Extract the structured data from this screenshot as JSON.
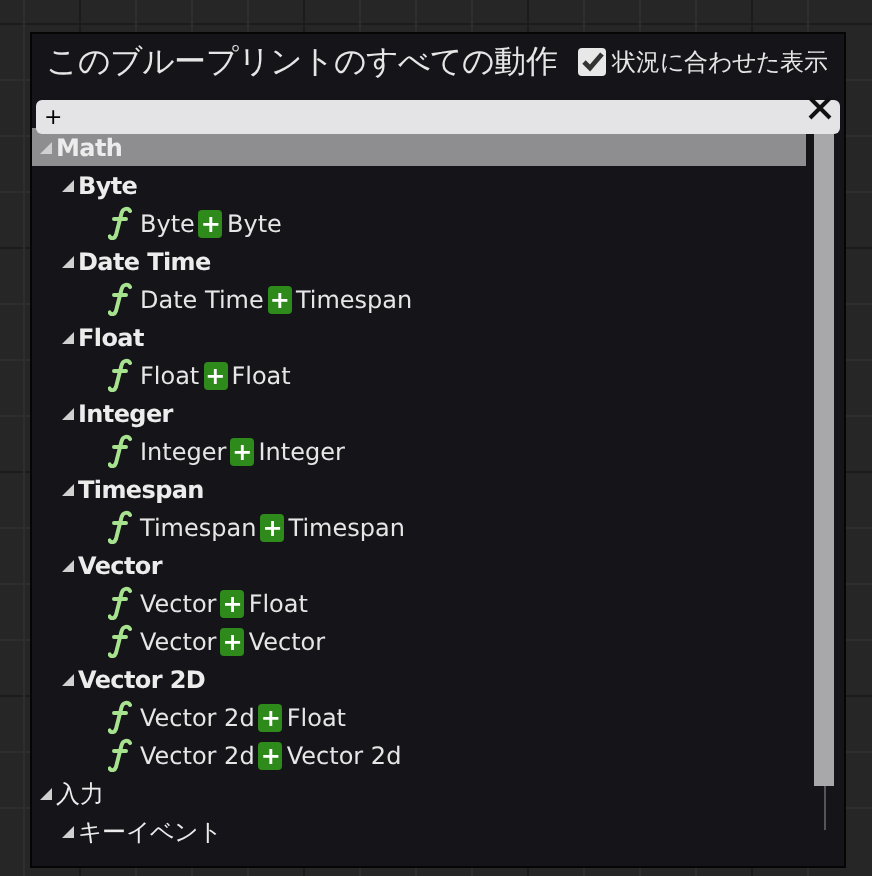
{
  "title": "このブループリントのすべての動作",
  "context_sensitive": {
    "label": "状況に合わせた表示",
    "checked": true
  },
  "search": {
    "value": "+"
  },
  "tree": [
    {
      "kind": "category",
      "label": "Math",
      "expanded": true,
      "selected": true,
      "children": [
        {
          "kind": "category",
          "label": "Byte",
          "expanded": true,
          "selected": false,
          "children": [
            {
              "kind": "function",
              "before": "Byte",
              "match": "+",
              "after": "Byte",
              "selected": false
            }
          ]
        },
        {
          "kind": "category",
          "label": "Date Time",
          "expanded": true,
          "selected": false,
          "children": [
            {
              "kind": "function",
              "before": "Date Time",
              "match": "+",
              "after": "Timespan",
              "selected": false
            }
          ]
        },
        {
          "kind": "category",
          "label": "Float",
          "expanded": true,
          "selected": false,
          "children": [
            {
              "kind": "function",
              "before": "Float",
              "match": "+",
              "after": "Float",
              "selected": false
            }
          ]
        },
        {
          "kind": "category",
          "label": "Integer",
          "expanded": true,
          "selected": false,
          "children": [
            {
              "kind": "function",
              "before": "Integer",
              "match": "+",
              "after": "Integer",
              "selected": false
            }
          ]
        },
        {
          "kind": "category",
          "label": "Timespan",
          "expanded": true,
          "selected": false,
          "children": [
            {
              "kind": "function",
              "before": "Timespan",
              "match": "+",
              "after": "Timespan",
              "selected": false
            }
          ]
        },
        {
          "kind": "category",
          "label": "Vector",
          "expanded": true,
          "selected": false,
          "children": [
            {
              "kind": "function",
              "before": "Vector",
              "match": "+",
              "after": "Float",
              "selected": false
            },
            {
              "kind": "function",
              "before": "Vector",
              "match": "+",
              "after": "Vector",
              "selected": false
            }
          ]
        },
        {
          "kind": "category",
          "label": "Vector 2D",
          "expanded": true,
          "selected": false,
          "children": [
            {
              "kind": "function",
              "before": "Vector 2d",
              "match": "+",
              "after": "Float",
              "selected": false
            },
            {
              "kind": "function",
              "before": "Vector 2d",
              "match": "+",
              "after": "Vector 2d",
              "selected": false
            }
          ]
        }
      ]
    },
    {
      "kind": "category",
      "label": "入力",
      "expanded": true,
      "selected": false,
      "children": [
        {
          "kind": "category",
          "label": "キーイベント",
          "expanded": true,
          "selected": false
        }
      ]
    }
  ]
}
